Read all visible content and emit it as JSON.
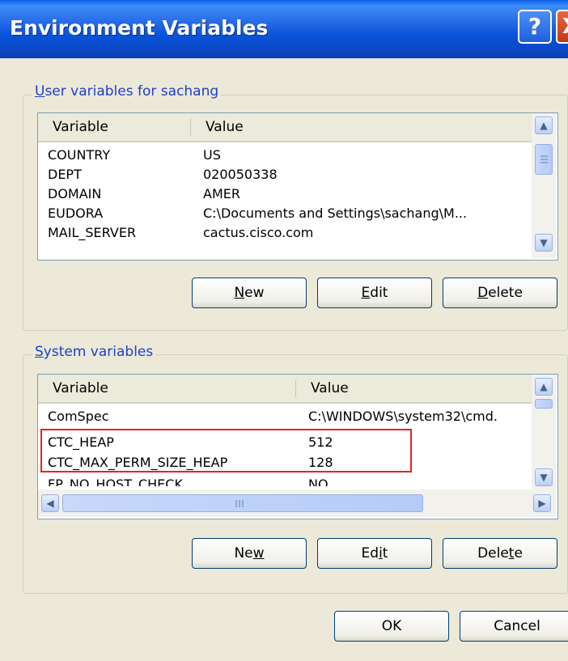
{
  "window": {
    "title": "Environment Variables",
    "help_glyph": "?",
    "close_glyph": "X"
  },
  "user_vars": {
    "legend_accel": "U",
    "legend_rest": "ser variables for sachang",
    "columns": [
      "Variable",
      "Value"
    ],
    "rows": [
      {
        "name": "COUNTRY",
        "value": "US"
      },
      {
        "name": "DEPT",
        "value": "020050338"
      },
      {
        "name": "DOMAIN",
        "value": "AMER"
      },
      {
        "name": "EUDORA",
        "value": "C:\\Documents and Settings\\sachang\\M..."
      },
      {
        "name": "MAIL_SERVER",
        "value": "cactus.cisco.com"
      }
    ],
    "buttons": {
      "new": {
        "accel": "N",
        "rest": "ew"
      },
      "edit": {
        "accel": "E",
        "rest": "dit"
      },
      "delete": {
        "accel": "D",
        "rest": "elete"
      }
    }
  },
  "system_vars": {
    "legend_accel": "S",
    "legend_rest": "ystem variables",
    "columns": [
      "Variable",
      "Value"
    ],
    "rows": [
      {
        "name": "ComSpec",
        "value": "C:\\WINDOWS\\system32\\cmd."
      },
      {
        "name": "CTC_HEAP",
        "value": "512"
      },
      {
        "name": "CTC_MAX_PERM_SIZE_HEAP",
        "value": "128"
      },
      {
        "name": "FP_NO_HOST_CHECK",
        "value": "NO"
      }
    ],
    "buttons": {
      "new": {
        "pre": "Ne",
        "accel": "w",
        "post": ""
      },
      "edit": {
        "pre": "Ed",
        "accel": "i",
        "post": "t"
      },
      "delete": {
        "pre": "Dele",
        "accel": "t",
        "post": "e"
      }
    }
  },
  "footer": {
    "ok_label": "OK",
    "cancel_label": "Cancel"
  },
  "colors": {
    "titlebar": "#0a53d8",
    "dialog_bg": "#ece9d8",
    "highlight_box": "#e32323",
    "legend_text": "#1e3fc8"
  }
}
